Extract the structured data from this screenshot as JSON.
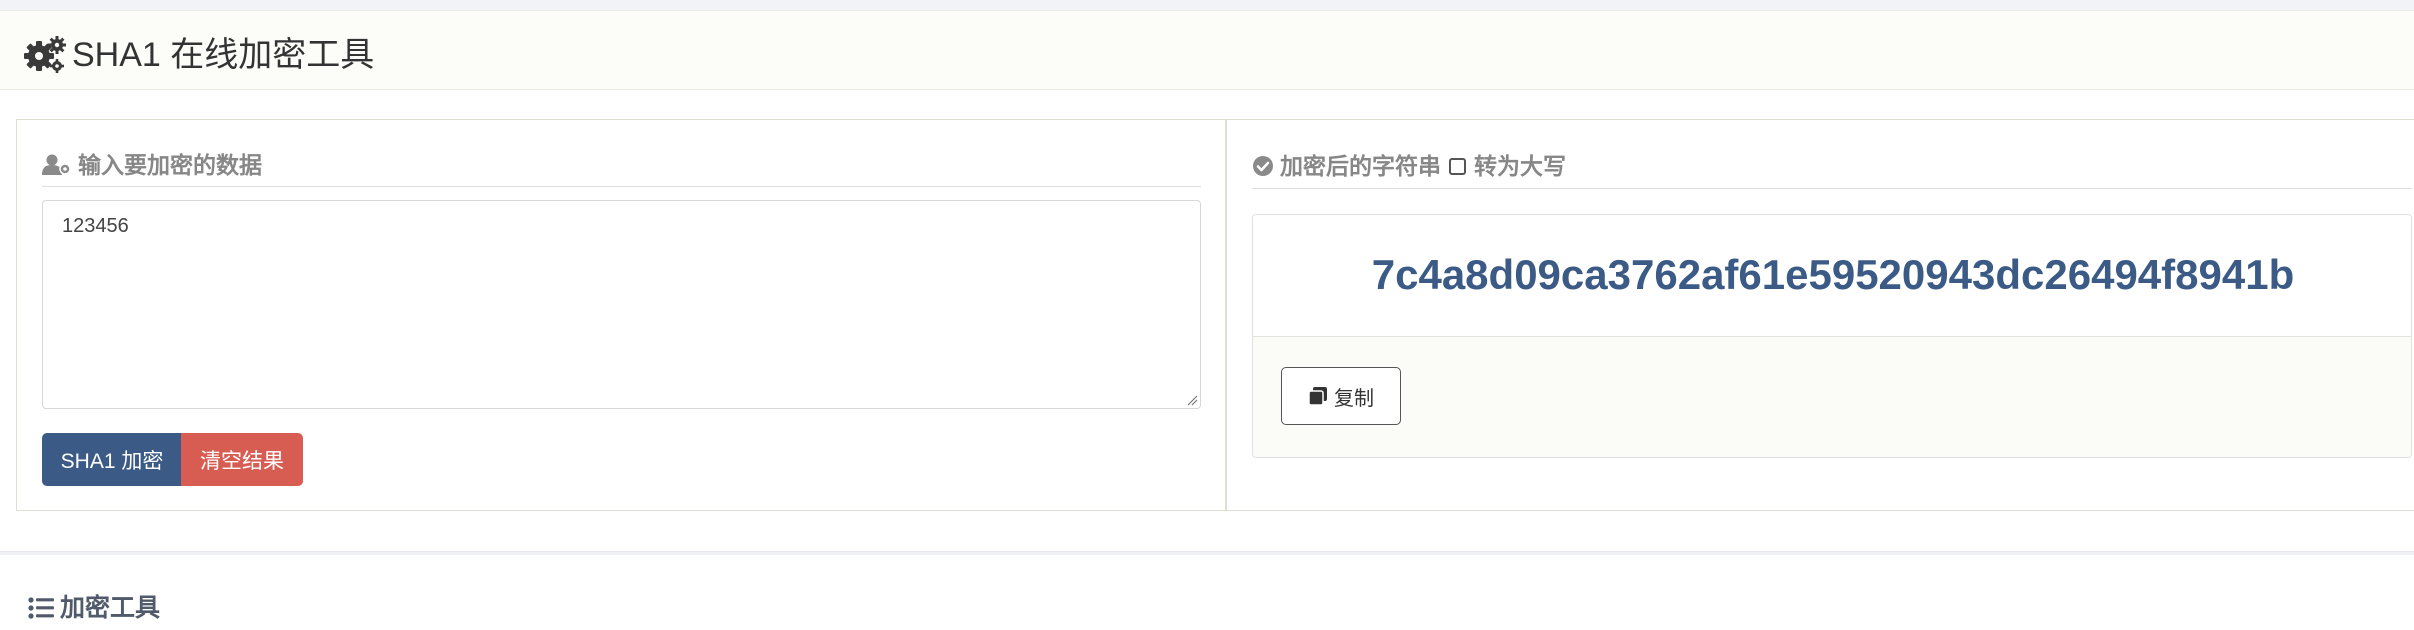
{
  "header": {
    "title": "SHA1 在线加密工具",
    "icon": "gears-icon"
  },
  "input_section": {
    "heading": "输入要加密的数据",
    "icon": "user-gear-icon",
    "value": "123456",
    "encrypt_button": "SHA1 加密",
    "clear_button": "清空结果"
  },
  "output_section": {
    "heading": "加密后的字符串",
    "icon": "check-circle-icon",
    "uppercase_label": "转为大写",
    "uppercase_checked": false,
    "result": "7c4a8d09ca3762af61e59520943dc26494f8941b",
    "copy_button": "复制",
    "copy_icon": "copy-icon"
  },
  "tools_section": {
    "heading": "加密工具",
    "icon": "list-icon"
  },
  "colors": {
    "primary": "#3b5b86",
    "danger": "#d75d52",
    "result_text": "#3b5b86"
  }
}
